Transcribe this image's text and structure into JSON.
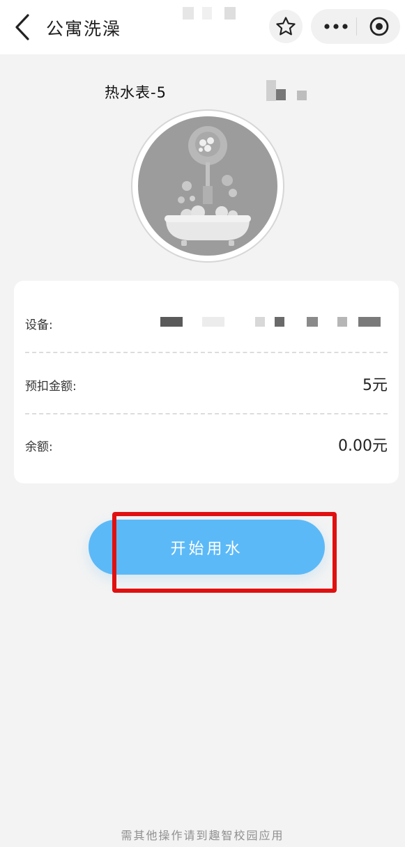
{
  "header": {
    "title": "公寓洗澡",
    "back_icon": "chevron-left-icon",
    "favorite_icon": "star-icon",
    "more_icon": "more-dots-icon",
    "close_icon": "target-icon"
  },
  "meter": {
    "name": "热水表-5",
    "illustration": "shower-bathtub-icon"
  },
  "info": {
    "device_label": "设备:",
    "prepay_label": "预扣金额:",
    "prepay_value": "5元",
    "balance_label": "余额:",
    "balance_value": "0.00元"
  },
  "actions": {
    "start_label": "开始用水",
    "button_color": "#5cb9f7",
    "highlight_color": "#e11010"
  },
  "footer": {
    "text": "需其他操作请到趣智校园应用"
  }
}
